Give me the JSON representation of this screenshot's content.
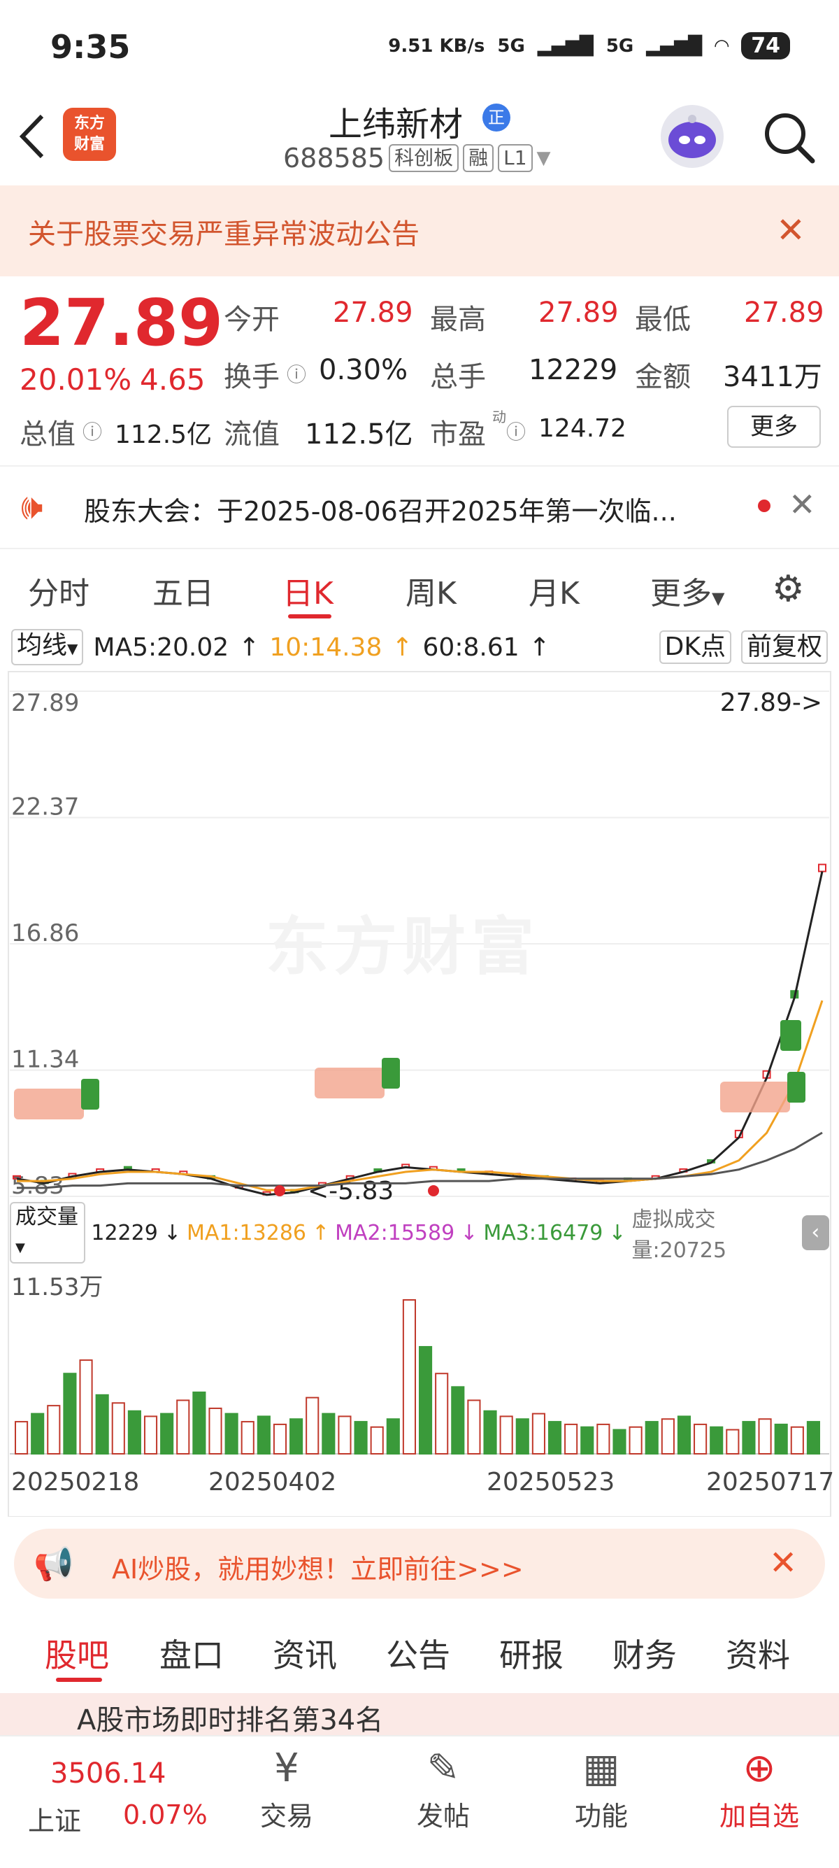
{
  "status_bar": {
    "time": "9:35",
    "speed": "9.51 KB/s",
    "net1": "5G",
    "net2": "5G",
    "battery": "74"
  },
  "header": {
    "logo_text": "东方财富",
    "stock_name": "上纬新材",
    "name_badge": "正",
    "code": "688585",
    "tags": [
      "科创板",
      "融",
      "L1"
    ]
  },
  "notice": {
    "text": "关于股票交易严重异常波动公告"
  },
  "quote": {
    "price": "27.89",
    "pct": "20.01%",
    "change": "4.65",
    "fields": [
      {
        "label": "今开",
        "value": "27.89",
        "red": true
      },
      {
        "label": "最高",
        "value": "27.89",
        "red": true
      },
      {
        "label": "最低",
        "value": "27.89",
        "red": true
      },
      {
        "label": "换手",
        "value": "0.30%",
        "red": false
      },
      {
        "label": "总手",
        "value": "12229",
        "red": false
      },
      {
        "label": "金额",
        "value": "3411万",
        "red": false
      },
      {
        "label": "总值",
        "value": "112.5亿",
        "red": false
      },
      {
        "label": "流值",
        "value": "112.5亿",
        "red": false
      },
      {
        "label": "市盈",
        "value": "124.72",
        "red": false
      }
    ],
    "pe_superscript": "动",
    "more_label": "更多"
  },
  "announcement": {
    "text": "股东大会：于2025-08-06召开2025年第一次临..."
  },
  "chart_tabs": [
    "分时",
    "五日",
    "日K",
    "周K",
    "月K",
    "更多"
  ],
  "active_tab": "日K",
  "ma_bar": {
    "selector": "均线",
    "ma5": "MA5:20.02",
    "ma10": "10:14.38",
    "ma60": "60:8.61",
    "dk": "DK点",
    "adjust": "前复权"
  },
  "volume_bar": {
    "selector": "成交量",
    "vol": "12229",
    "ma1": "MA1:13286",
    "ma2": "MA2:15589",
    "ma3": "MA3:16479",
    "virtual": "虚拟成交量:20725",
    "max_label": "11.53万"
  },
  "chart_data": {
    "type": "line",
    "price_axis": [
      "27.89",
      "22.37",
      "16.86",
      "11.34",
      "5.83"
    ],
    "last_price_label": "27.89->",
    "low_label": "<-5.83",
    "x_labels": [
      "20250218",
      "20250402",
      "20250523",
      "20250717"
    ],
    "series": [
      {
        "name": "MA5",
        "color": "#222222",
        "values": [
          6.6,
          6.4,
          6.7,
          6.9,
          7.0,
          6.9,
          6.8,
          6.6,
          6.2,
          5.9,
          6.0,
          6.3,
          6.6,
          6.9,
          7.1,
          7.0,
          6.9,
          6.8,
          6.7,
          6.6,
          6.5,
          6.4,
          6.5,
          6.6,
          6.9,
          7.3,
          8.4,
          11.0,
          14.5,
          20.02
        ]
      },
      {
        "name": "MA10",
        "color": "#f0a020",
        "values": [
          6.5,
          6.5,
          6.6,
          6.8,
          6.9,
          6.9,
          6.8,
          6.7,
          6.4,
          6.1,
          6.1,
          6.3,
          6.5,
          6.7,
          6.9,
          7.0,
          6.9,
          6.9,
          6.8,
          6.7,
          6.6,
          6.5,
          6.5,
          6.6,
          6.7,
          6.9,
          7.4,
          8.6,
          10.8,
          14.38
        ]
      },
      {
        "name": "MA60",
        "color": "#555555",
        "values": [
          6.2,
          6.2,
          6.3,
          6.3,
          6.4,
          6.4,
          6.4,
          6.4,
          6.3,
          6.3,
          6.3,
          6.3,
          6.4,
          6.4,
          6.4,
          6.5,
          6.5,
          6.5,
          6.6,
          6.6,
          6.6,
          6.6,
          6.6,
          6.6,
          6.7,
          6.8,
          7.0,
          7.4,
          7.9,
          8.61
        ]
      }
    ],
    "volume": [
      24,
      30,
      36,
      60,
      70,
      44,
      38,
      32,
      28,
      30,
      40,
      46,
      34,
      30,
      24,
      28,
      22,
      26,
      42,
      30,
      28,
      24,
      20,
      26,
      115,
      80,
      60,
      50,
      40,
      32,
      28,
      26,
      30,
      24,
      22,
      20,
      22,
      18,
      20,
      24,
      26,
      28,
      22,
      20,
      18,
      24,
      26,
      22,
      20,
      24
    ],
    "volume_max": 115300
  },
  "ad": {
    "text": "AI炒股，就用妙想！立即前往>>>"
  },
  "sub_tabs": [
    "股吧",
    "盘口",
    "资讯",
    "公告",
    "研报",
    "财务",
    "资料"
  ],
  "peek_text": "A股市场即时排名第34名",
  "bottom_nav": {
    "index_value": "3506.14",
    "index_name": "上证",
    "index_pct": "0.07%",
    "items": [
      "交易",
      "发帖",
      "功能",
      "加自选"
    ]
  }
}
